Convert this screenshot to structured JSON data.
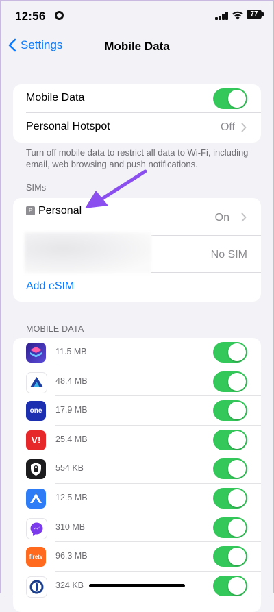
{
  "status": {
    "time": "12:56",
    "battery": "77"
  },
  "nav": {
    "back_label": "Settings",
    "title": "Mobile Data"
  },
  "main": {
    "mobile_data_label": "Mobile Data",
    "hotspot_label": "Personal Hotspot",
    "hotspot_value": "Off",
    "footnote": "Turn off mobile data to restrict all data to Wi-Fi, including email, web browsing and push notifications."
  },
  "sims": {
    "header": "SIMs",
    "badge": "P",
    "sim1_name": "Personal",
    "sim1_value": "On",
    "sim2_value": "No SIM",
    "add_esim": "Add eSIM"
  },
  "mobile_data_section": {
    "header": "MOBILE DATA",
    "apps": [
      {
        "size": "11.5 MB",
        "icon": "shortcuts-icon",
        "color": "#4a3fd1"
      },
      {
        "size": "48.4 MB",
        "icon": "finance-app-icon",
        "color": "#ffffff"
      },
      {
        "size": "17.9 MB",
        "icon": "onescore-icon",
        "color": "#1c2fb0",
        "text": "one"
      },
      {
        "size": "25.4 MB",
        "icon": "vi-icon",
        "color": "#e6282b",
        "text": "V!"
      },
      {
        "size": "554 KB",
        "icon": "vpn-lock-icon",
        "color": "#1c1c1e"
      },
      {
        "size": "12.5 MB",
        "icon": "nordvpn-icon",
        "color": "#2f7df6"
      },
      {
        "size": "310 MB",
        "icon": "messenger-icon",
        "color": "#ffffff"
      },
      {
        "size": "96.3 MB",
        "icon": "firetv-icon",
        "color": "#ff6a1e",
        "text": "firetv"
      },
      {
        "size": "324 KB",
        "icon": "1password-icon",
        "color": "#ffffff"
      }
    ]
  },
  "colors": {
    "accent": "#0a7aff",
    "toggle_on": "#34c759",
    "annotation_arrow": "#8b4ff0"
  }
}
